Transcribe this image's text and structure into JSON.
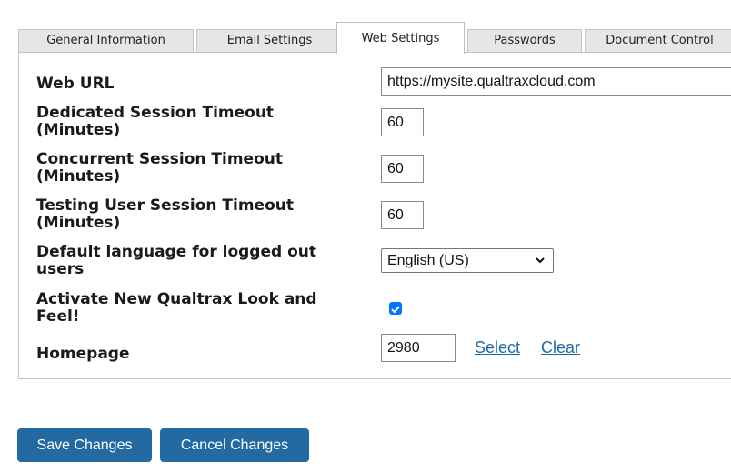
{
  "tabs": [
    {
      "label": "General Information"
    },
    {
      "label": "Email Settings"
    },
    {
      "label": "Web Settings",
      "active": true
    },
    {
      "label": "Passwords"
    },
    {
      "label": "Document Control"
    }
  ],
  "form": {
    "web_url": {
      "label": "Web URL",
      "value": "https://mysite.qualtraxcloud.com"
    },
    "dedicated_timeout": {
      "label_line1": "Dedicated Session Timeout",
      "label_line2": "(Minutes)",
      "value": "60"
    },
    "concurrent_timeout": {
      "label_line1": "Concurrent Session Timeout",
      "label_line2": "(Minutes)",
      "value": "60"
    },
    "testing_timeout": {
      "label_line1": "Testing User Session Timeout",
      "label_line2": "(Minutes)",
      "value": "60"
    },
    "default_language": {
      "label_line1": "Default language for logged out",
      "label_line2": "users",
      "value": "English (US)"
    },
    "new_look": {
      "label_line1": "Activate New Qualtrax Look and",
      "label_line2": "Feel!",
      "checked": true
    },
    "homepage": {
      "label": "Homepage",
      "value": "2980",
      "select_label": "Select",
      "clear_label": "Clear"
    }
  },
  "buttons": {
    "save": "Save Changes",
    "cancel": "Cancel Changes"
  },
  "colors": {
    "button_bg": "#236aa3",
    "link": "#1e6aa8",
    "checkbox": "#0075ff"
  }
}
